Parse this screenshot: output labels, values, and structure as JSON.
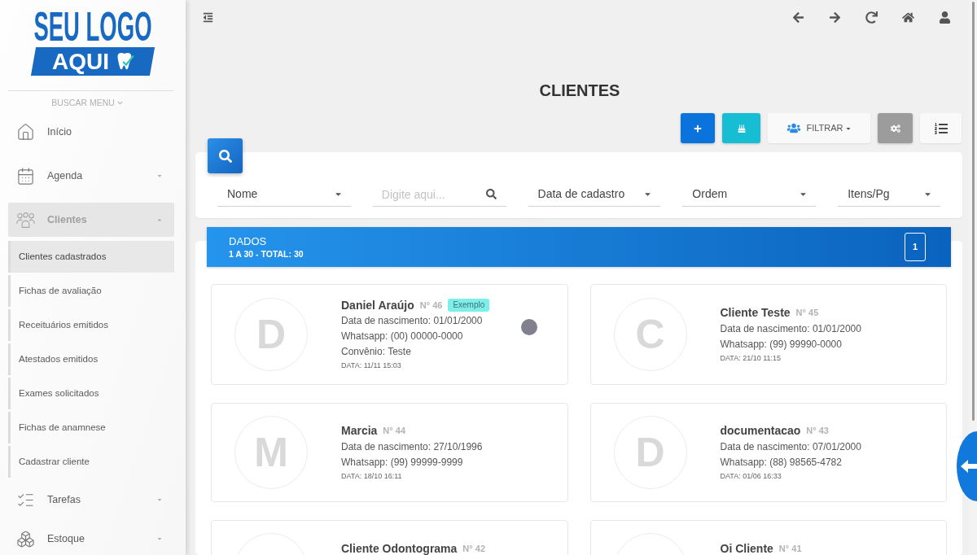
{
  "sidebar": {
    "logo": {
      "line_1": "SEU LOGO",
      "line_2": "AQUI"
    },
    "search_menu": "BUSCAR MENU",
    "items": [
      {
        "kind": "link",
        "label": "Início",
        "selected": false
      },
      {
        "kind": "group",
        "label": "Agenda",
        "selected": false,
        "expanded": false
      },
      {
        "kind": "group",
        "label": "Clientes",
        "selected": true,
        "expanded": true,
        "children": [
          {
            "label": "Clientes cadastrados",
            "selected": true
          },
          {
            "label": "Fichas de avaliação",
            "selected": false
          },
          {
            "label": "Receituários emitidos",
            "selected": false
          },
          {
            "label": "Atestados emitidos",
            "selected": false
          },
          {
            "label": "Exames solicitados",
            "selected": false
          },
          {
            "label": "Fichas de anamnese",
            "selected": false
          },
          {
            "label": "Cadastrar cliente",
            "selected": false
          }
        ]
      },
      {
        "kind": "group",
        "label": "Tarefas",
        "selected": false,
        "expanded": false
      },
      {
        "kind": "group",
        "label": "Estoque",
        "selected": false,
        "expanded": false
      }
    ]
  },
  "page": {
    "title": "CLIENTES"
  },
  "toolbar": {
    "filter_label": "FILTRAR"
  },
  "search": {
    "fields": [
      {
        "kind": "select",
        "value": "Nome"
      },
      {
        "kind": "search",
        "placeholder": "Digite aqui..."
      },
      {
        "kind": "select",
        "value": "Data de cadastro"
      },
      {
        "kind": "select",
        "value": "Ordem"
      },
      {
        "kind": "select",
        "value": "Itens/Pg"
      }
    ]
  },
  "results": {
    "title": "DADOS",
    "summary": "1 A 30 - TOTAL: 30",
    "page": "1",
    "clients": [
      {
        "initial": "D",
        "name": "Daniel Araújo",
        "number": "N° 46",
        "badge": "Exemplo",
        "details": [
          "Data de nascimento: 01/01/2000",
          "Whatsapp: (00) 00000-0000",
          "Convênio: Teste"
        ],
        "date": "DATA: 11/11 15:03",
        "color": "#80808f"
      },
      {
        "initial": "C",
        "name": "Cliente Teste",
        "number": "N° 45",
        "details": [
          "Data de nascimento: 01/01/2000",
          "Whatsapp: (99) 99990-0000"
        ],
        "date": "DATA: 21/10 11:15"
      },
      {
        "initial": "M",
        "name": "Marcia",
        "number": "N° 44",
        "details": [
          "Data de nascimento: 27/10/1996",
          "Whatsapp: (99) 99999-9999"
        ],
        "date": "DATA: 18/10 16:11"
      },
      {
        "initial": "D",
        "name": "documentacao",
        "number": "N° 43",
        "details": [
          "Data de nascimento: 07/01/2000",
          "Whatsapp: (88) 98565-4782"
        ],
        "date": "DATA: 01/06 16:33"
      },
      {
        "name": "Cliente Odontograma",
        "number": "N° 42"
      },
      {
        "name": "Oi Cliente",
        "number": "N° 41"
      }
    ]
  }
}
